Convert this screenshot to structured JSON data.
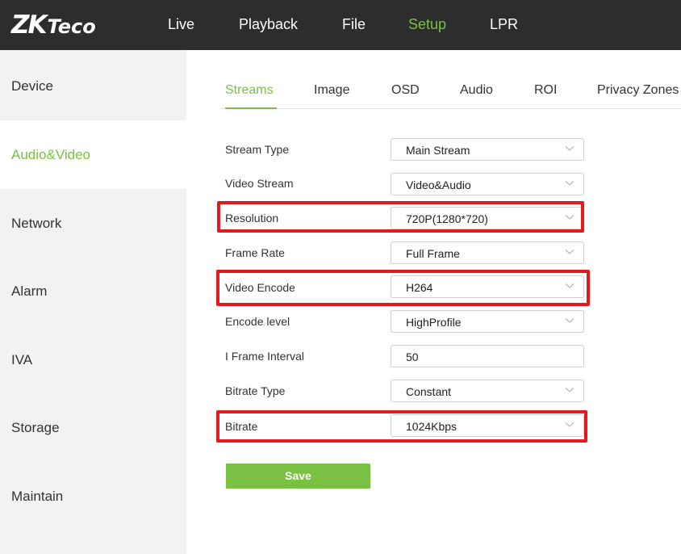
{
  "app": {
    "logo": {
      "main": "ZK",
      "sub": "Teco"
    }
  },
  "nav": [
    {
      "label": "Live",
      "active": false
    },
    {
      "label": "Playback",
      "active": false
    },
    {
      "label": "File",
      "active": false
    },
    {
      "label": "Setup",
      "active": true
    },
    {
      "label": "LPR",
      "active": false
    }
  ],
  "sidebar": [
    {
      "label": "Device",
      "active": false
    },
    {
      "label": "Audio&Video",
      "active": true
    },
    {
      "label": "Network",
      "active": false
    },
    {
      "label": "Alarm",
      "active": false
    },
    {
      "label": "IVA",
      "active": false
    },
    {
      "label": "Storage",
      "active": false
    },
    {
      "label": "Maintain",
      "active": false
    }
  ],
  "tabs": [
    {
      "label": "Streams",
      "active": true
    },
    {
      "label": "Image",
      "active": false
    },
    {
      "label": "OSD",
      "active": false
    },
    {
      "label": "Audio",
      "active": false
    },
    {
      "label": "ROI",
      "active": false
    },
    {
      "label": "Privacy Zones",
      "active": false
    }
  ],
  "form": {
    "fields": [
      {
        "label": "Stream Type",
        "value": "Main Stream",
        "control": "select",
        "highlighted": false
      },
      {
        "label": "Video Stream",
        "value": "Video&Audio",
        "control": "select",
        "highlighted": false
      },
      {
        "label": "Resolution",
        "value": "720P(1280*720)",
        "control": "select",
        "highlighted": true
      },
      {
        "label": "Frame Rate",
        "value": "Full Frame",
        "control": "select",
        "highlighted": false
      },
      {
        "label": "Video Encode",
        "value": "H264",
        "control": "select",
        "highlighted": true
      },
      {
        "label": "Encode level",
        "value": "HighProfile",
        "control": "select",
        "highlighted": false
      },
      {
        "label": "I Frame Interval",
        "value": "50",
        "control": "input",
        "highlighted": false
      },
      {
        "label": "Bitrate Type",
        "value": "Constant",
        "control": "select",
        "highlighted": false
      },
      {
        "label": "Bitrate",
        "value": "1024Kbps",
        "control": "select",
        "highlighted": true
      }
    ],
    "save_label": "Save"
  },
  "colors": {
    "accent": "#7ac143",
    "topbar": "#2d2d2d",
    "sidebar": "#f2f2f2",
    "highlight": "#e5171f"
  }
}
